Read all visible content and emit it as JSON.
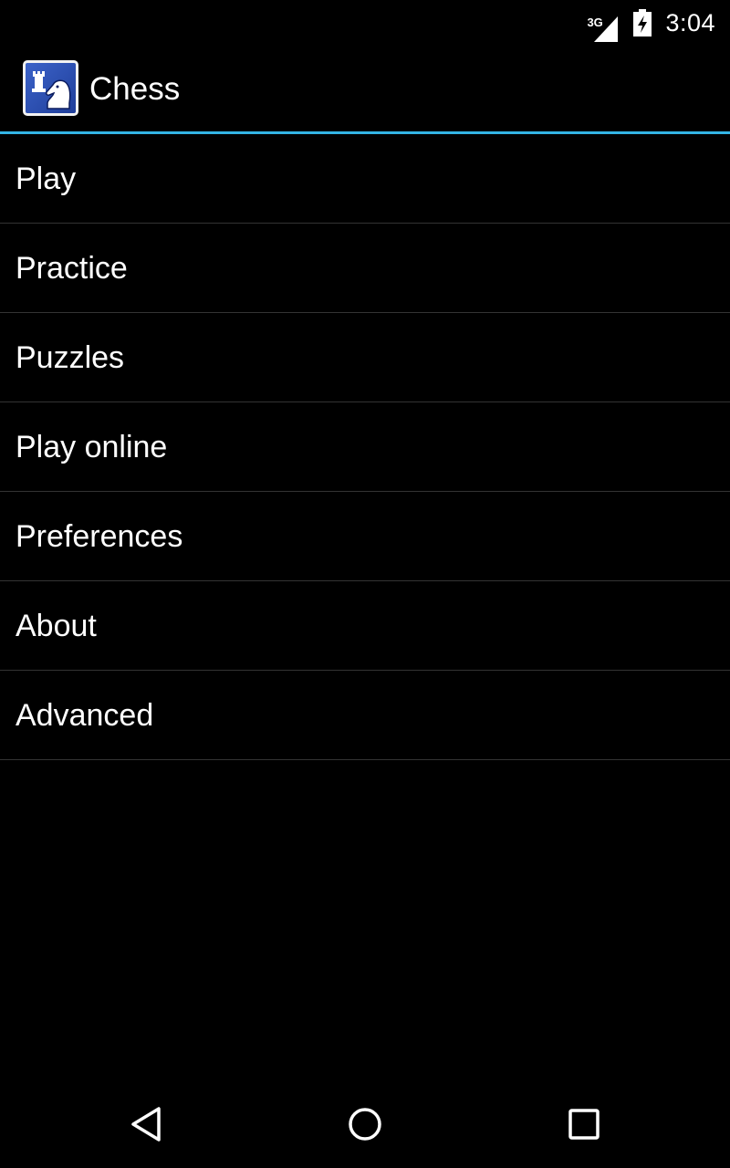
{
  "status_bar": {
    "network_label": "3G",
    "time": "3:04",
    "icons": [
      "signal-icon",
      "battery-charging-icon"
    ]
  },
  "action_bar": {
    "title": "Chess",
    "icon": "chess-app-icon",
    "accent_color": "#33b5e5"
  },
  "menu": {
    "items": [
      {
        "label": "Play"
      },
      {
        "label": "Practice"
      },
      {
        "label": "Puzzles"
      },
      {
        "label": "Play online"
      },
      {
        "label": "Preferences"
      },
      {
        "label": "About"
      },
      {
        "label": "Advanced"
      }
    ]
  },
  "nav_bar": {
    "icons": [
      "back-icon",
      "home-icon",
      "recents-icon"
    ]
  },
  "colors": {
    "background": "#000000",
    "text": "#ffffff",
    "divider": "#333333",
    "accent": "#33b5e5"
  }
}
